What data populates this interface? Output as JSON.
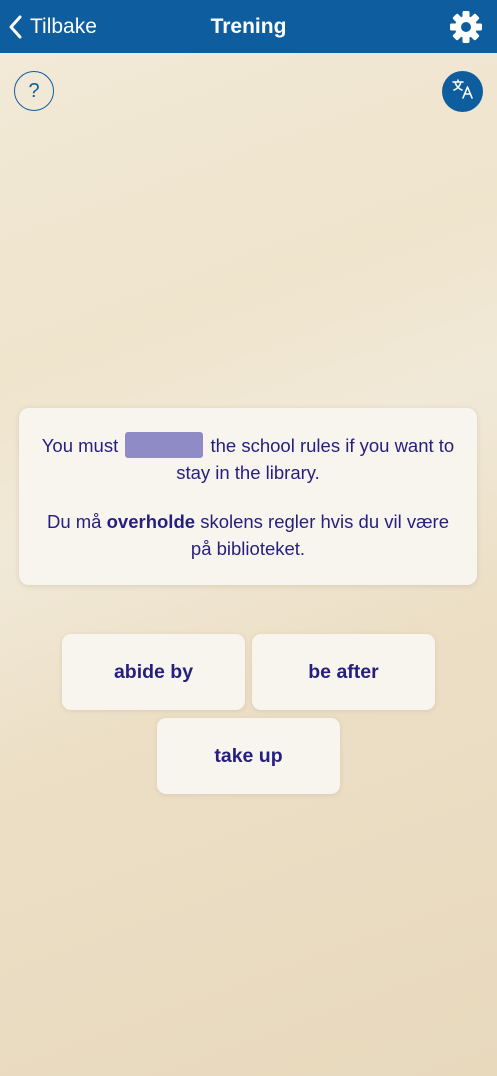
{
  "header": {
    "back_label": "Tilbake",
    "title": "Trening",
    "back_icon": "chevron-left-icon",
    "settings_icon": "gear-icon"
  },
  "help": {
    "label": "?",
    "icon": "help-icon"
  },
  "translate": {
    "icon": "translate-icon"
  },
  "exercise": {
    "en_before": "You must",
    "en_after": "the school rules if you want to stay in the library.",
    "no_before": "Du må",
    "no_keyword": "overholde",
    "no_after": "skolens regler hvis du vil være på biblioteket."
  },
  "options": [
    "abide by",
    "be after",
    "take up"
  ],
  "colors": {
    "header": "#0e5d9f",
    "text": "#251f7f",
    "blank": "#8f8bc7",
    "card": "#f8f4ee"
  }
}
